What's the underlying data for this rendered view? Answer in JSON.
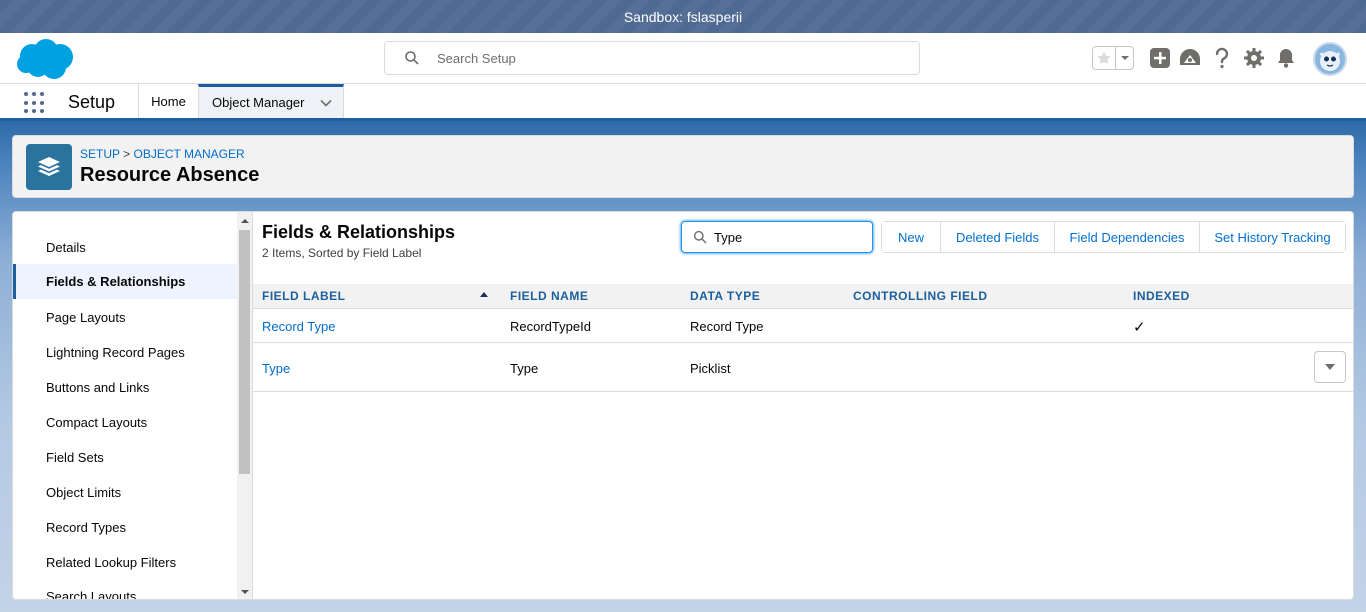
{
  "sandbox": {
    "label": "Sandbox: fslasperii"
  },
  "header": {
    "search_placeholder": "Search Setup"
  },
  "context": {
    "app_name": "Setup",
    "tabs": [
      {
        "label": "Home"
      },
      {
        "label": "Object Manager"
      }
    ]
  },
  "page": {
    "breadcrumb": [
      "SETUP",
      "OBJECT MANAGER"
    ],
    "breadcrumb_sep": ">",
    "title": "Resource Absence"
  },
  "sidebar": {
    "items": [
      {
        "label": "Details"
      },
      {
        "label": "Fields & Relationships"
      },
      {
        "label": "Page Layouts"
      },
      {
        "label": "Lightning Record Pages"
      },
      {
        "label": "Buttons and Links"
      },
      {
        "label": "Compact Layouts"
      },
      {
        "label": "Field Sets"
      },
      {
        "label": "Object Limits"
      },
      {
        "label": "Record Types"
      },
      {
        "label": "Related Lookup Filters"
      },
      {
        "label": "Search Layouts"
      }
    ],
    "active_index": 1
  },
  "main": {
    "title": "Fields & Relationships",
    "subtitle": "2 Items, Sorted by Field Label",
    "quick_find_value": "Type",
    "buttons": [
      "New",
      "Deleted Fields",
      "Field Dependencies",
      "Set History Tracking"
    ],
    "columns": [
      "FIELD LABEL",
      "FIELD NAME",
      "DATA TYPE",
      "CONTROLLING FIELD",
      "INDEXED"
    ],
    "rows": [
      {
        "field_label": "Record Type",
        "field_name": "RecordTypeId",
        "data_type": "Record Type",
        "controlling_field": "",
        "indexed": "✓"
      },
      {
        "field_label": "Type",
        "field_name": "Type",
        "data_type": "Picklist",
        "controlling_field": "",
        "indexed": ""
      }
    ]
  },
  "colors": {
    "brand": "#1b5f9e",
    "link": "#006dcc",
    "object_icon": "#2a739e",
    "salesforce_cloud": "#00a1e0"
  },
  "icons": [
    "salesforce-logo",
    "search-icon",
    "star-icon",
    "chevron-down-icon",
    "plus-icon",
    "trailhead-icon",
    "help-icon",
    "gear-icon",
    "bell-icon",
    "avatar",
    "app-launcher-icon",
    "layers-icon",
    "sort-up-icon",
    "checkmark-icon"
  ]
}
